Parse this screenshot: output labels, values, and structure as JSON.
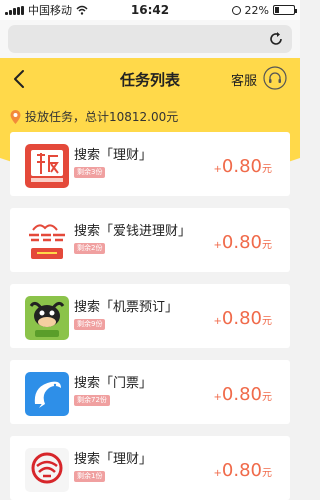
{
  "status_bar": {
    "carrier": "中国移动",
    "time": "16:42",
    "battery": "22%",
    "battery_level": 0.22
  },
  "header": {
    "title": "任务列表",
    "service_label": "客服"
  },
  "summary": {
    "text": "投放任务，总计10812.00元"
  },
  "tasks": [
    {
      "name": "搜索「理财」",
      "remain": "剩余3份",
      "plus": "+",
      "amount": "0.80",
      "unit": "元",
      "icon": "ban-app-icon"
    },
    {
      "name": "搜索「爱钱进理财」",
      "remain": "剩余2份",
      "plus": "+",
      "amount": "0.80",
      "unit": "元",
      "icon": "lingyongdai-app-icon"
    },
    {
      "name": "搜索「机票预订」",
      "remain": "剩余9份",
      "plus": "+",
      "amount": "0.80",
      "unit": "元",
      "icon": "cow-app-icon"
    },
    {
      "name": "搜索「门票」",
      "remain": "剩余72份",
      "plus": "+",
      "amount": "0.80",
      "unit": "元",
      "icon": "dolphin-app-icon"
    },
    {
      "name": "搜索「理财」",
      "remain": "剩余1份",
      "plus": "+",
      "amount": "0.80",
      "unit": "元",
      "icon": "red-logo-app-icon"
    }
  ],
  "colors": {
    "header_yellow": "#ffd94a",
    "price_red": "#f06a4a",
    "badge_pink": "#f0a0a0"
  }
}
